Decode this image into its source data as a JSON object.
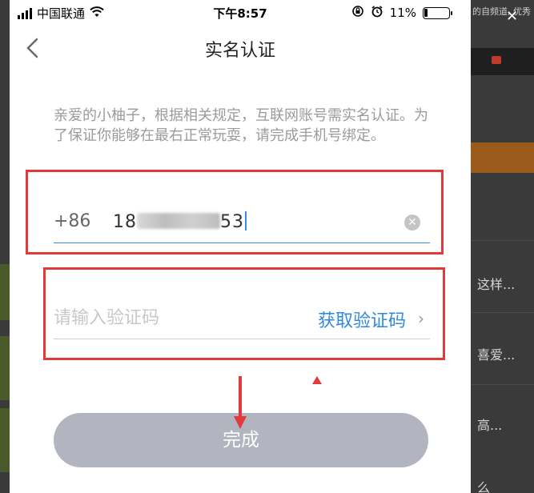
{
  "status_bar": {
    "carrier": "中国联通",
    "time": "下午8:57",
    "battery": "11%"
  },
  "background": {
    "top_text": "的自频道, 优秀",
    "snippets": [
      "这样...",
      "喜爱...",
      "高...",
      "么"
    ]
  },
  "nav": {
    "title": "实名认证"
  },
  "notice": "亲爱的小柚子，根据相关规定，互联网账号需实名认证。为了保证你能够在最右正常玩耍，请完成手机号绑定。",
  "phone": {
    "country_code": "+86",
    "prefix": "18",
    "suffix": "53"
  },
  "verification": {
    "placeholder": "请输入验证码",
    "get_code_label": "获取验证码"
  },
  "done_label": "完成",
  "colors": {
    "accent": "#2d8ae0",
    "button_disabled": "#b2b4bf",
    "annotation": "#e03a3a"
  }
}
